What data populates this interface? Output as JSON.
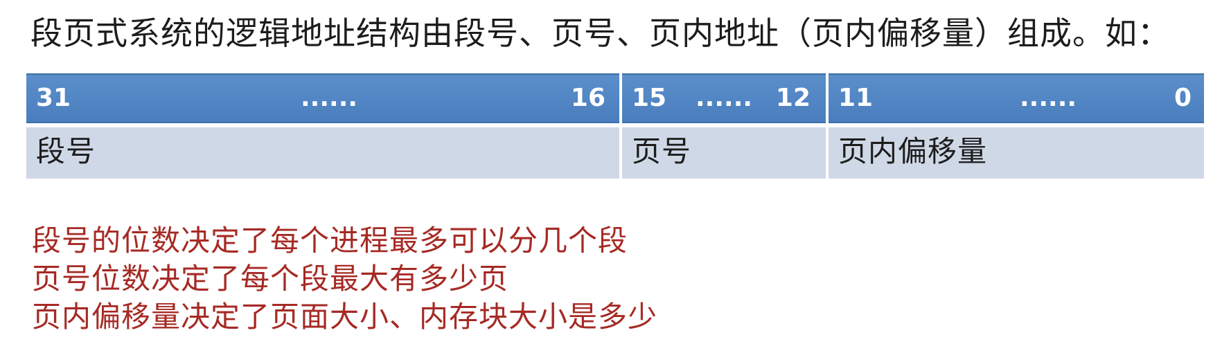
{
  "intro": "段页式系统的逻辑地址结构由段号、页号、页内地址（页内偏移量）组成。如：",
  "address_table": {
    "segment": {
      "high_bit": "31",
      "dots": "......",
      "low_bit": "16",
      "label": "段号"
    },
    "page": {
      "high_bit": "15",
      "dots": "......",
      "low_bit": "12",
      "label": "页号"
    },
    "offset": {
      "high_bit": "11",
      "dots": "......",
      "low_bit": "0",
      "label": "页内偏移量"
    }
  },
  "notes": [
    "段号的位数决定了每个进程最多可以分几个段",
    "页号位数决定了每个段最大有多少页",
    "页内偏移量决定了页面大小、内存块大小是多少"
  ],
  "colors": {
    "header_blue": "#4f86c6",
    "label_gray": "#cfd8e6",
    "note_red": "#a62a24"
  }
}
